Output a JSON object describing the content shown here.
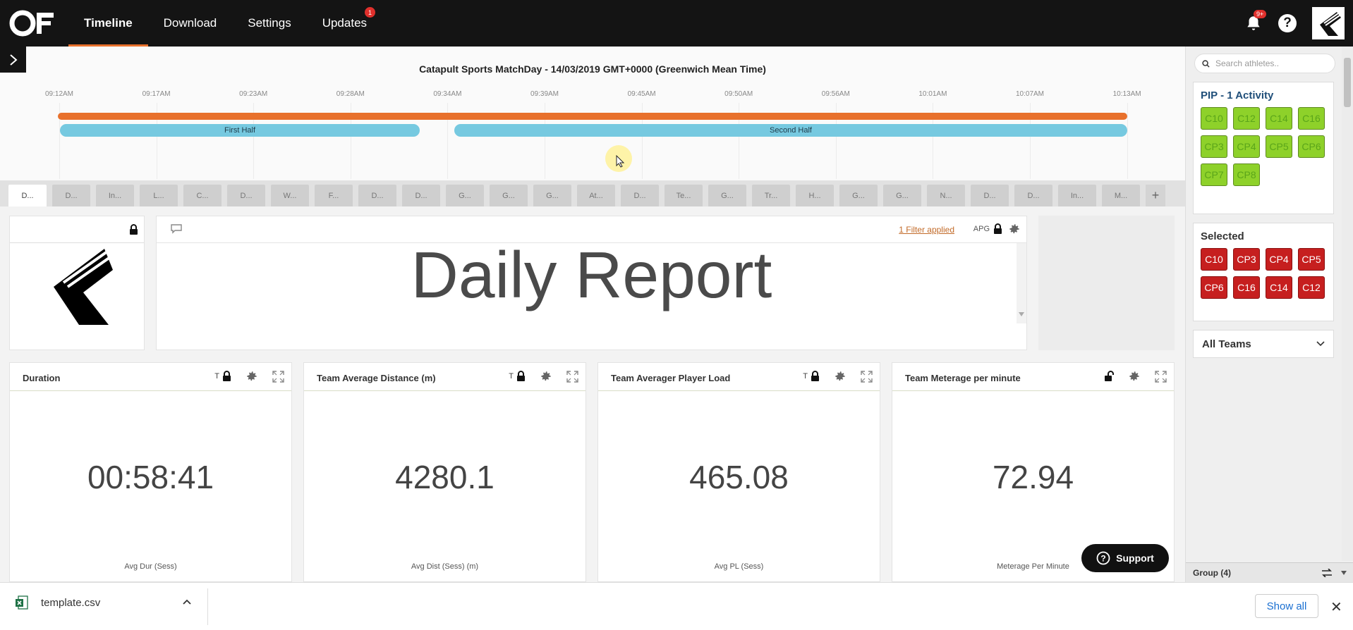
{
  "nav": {
    "items": [
      {
        "label": "Timeline",
        "active": true
      },
      {
        "label": "Download"
      },
      {
        "label": "Settings"
      },
      {
        "label": "Updates",
        "badge": "1"
      }
    ],
    "notifications_badge": "9+",
    "help_label": "?"
  },
  "timeline": {
    "title": "Catapult Sports MatchDay - 14/03/2019 GMT+0000 (Greenwich Mean Time)",
    "ticks": [
      "09:12AM",
      "09:17AM",
      "09:23AM",
      "09:28AM",
      "09:34AM",
      "09:39AM",
      "09:45AM",
      "09:50AM",
      "09:56AM",
      "10:01AM",
      "10:07AM",
      "10:13AM"
    ],
    "periods": [
      {
        "label": "First Half"
      },
      {
        "label": "Second Half"
      }
    ],
    "session_color": "#e8712c",
    "period_color": "#76c9e0"
  },
  "tabs": [
    "D...",
    "D...",
    "In...",
    "L...",
    "C...",
    "D...",
    "W...",
    "F...",
    "D...",
    "D...",
    "G...",
    "G...",
    "G...",
    "At...",
    "D...",
    "Te...",
    "G...",
    "Tr...",
    "H...",
    "G...",
    "G...",
    "N...",
    "D...",
    "D...",
    "In...",
    "M..."
  ],
  "tab_add": "+",
  "report": {
    "filter_label": "1 Filter applied",
    "apg_label": "APG",
    "title": "Daily Report"
  },
  "widgets": [
    {
      "title": "Duration",
      "t_label": "T",
      "locked": true,
      "value": "00:58:41",
      "sub": "Avg Dur (Sess)"
    },
    {
      "title": "Team Average Distance (m)",
      "t_label": "T",
      "locked": true,
      "value": "4280.1",
      "sub": "Avg Dist (Sess) (m)"
    },
    {
      "title": "Team Averager Player Load",
      "t_label": "T",
      "locked": true,
      "value": "465.08",
      "sub": "Avg PL (Sess)"
    },
    {
      "title": "Team Meterage per minute",
      "t_label": "",
      "locked": false,
      "value": "72.94",
      "sub": "Meterage Per Minute"
    }
  ],
  "sidebar": {
    "search_placeholder": "Search athletes..",
    "activity_title": "PIP - 1 Activity",
    "activity_chips": [
      "C10",
      "C12",
      "C14",
      "C16",
      "CP3",
      "CP4",
      "CP5",
      "CP6",
      "CP7",
      "CP8"
    ],
    "selected_title": "Selected",
    "selected_chips": [
      "C10",
      "CP3",
      "CP4",
      "CP5",
      "CP6",
      "C16",
      "C14",
      "C12"
    ],
    "teams_label": "All Teams",
    "group_label": "Group (4)",
    "accent_green": "#8ed12a",
    "accent_red": "#c61f1f",
    "title_color": "#1f4e79"
  },
  "support_label": "Support",
  "download_bar": {
    "file_name": "template.csv",
    "show_all": "Show all"
  }
}
